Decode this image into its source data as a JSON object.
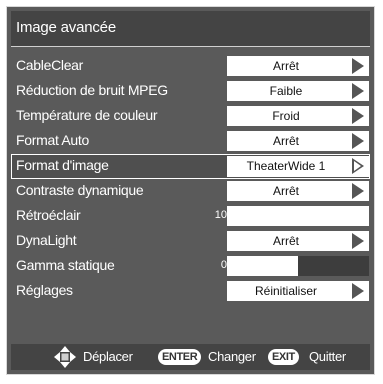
{
  "menu": {
    "title": "Image avancée"
  },
  "items": [
    {
      "label": "CableClear",
      "value": "Arrêt"
    },
    {
      "label": "Réduction de bruit MPEG",
      "value": "Faible"
    },
    {
      "label": "Température de couleur",
      "value": "Froid"
    },
    {
      "label": "Format Auto",
      "value": "Arrêt"
    },
    {
      "label": "Format d'image",
      "value": "TheaterWide 1"
    },
    {
      "label": "Contraste dynamique",
      "value": "Arrêt"
    },
    {
      "label": "Rétroéclair",
      "number": "10",
      "level": 1.0
    },
    {
      "label": "DynaLight",
      "value": "Arrêt"
    },
    {
      "label": "Gamma statique",
      "number": "0",
      "level": 0.5
    },
    {
      "label": "Réglages",
      "value": "Réinitialiser"
    }
  ],
  "footer": {
    "move_label": "Déplacer",
    "enter_key": "ENTER",
    "enter_label": "Changer",
    "exit_key": "EXIT",
    "exit_label": "Quitter"
  },
  "colors": {
    "panel": "#5a5a5a",
    "header": "#444444",
    "slider_track": "#3d3d3d",
    "value_box": "#ffffff"
  },
  "icons": {
    "navigate": "four-way-arrows-icon",
    "value_arrow": "triangle-right-icon"
  }
}
